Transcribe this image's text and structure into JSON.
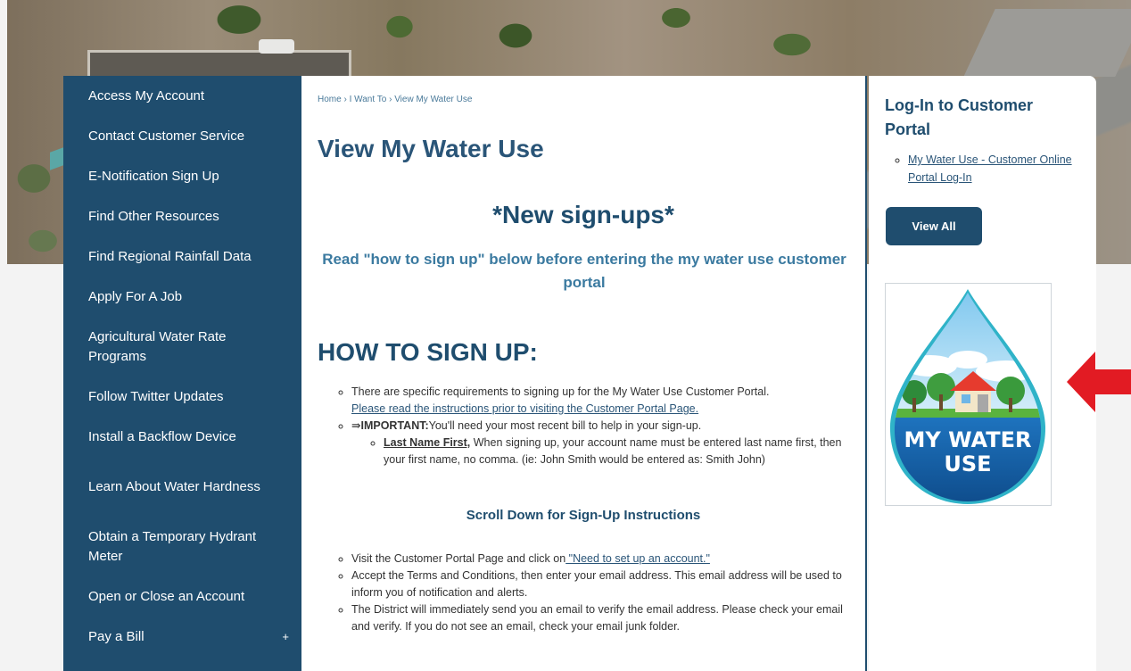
{
  "sidebar": {
    "items": [
      {
        "label": "Access My Account"
      },
      {
        "label": "Contact Customer Service"
      },
      {
        "label": "E-Notification Sign Up"
      },
      {
        "label": "Find Other Resources"
      },
      {
        "label": "Find Regional Rainfall Data"
      },
      {
        "label": "Apply For A Job"
      },
      {
        "label": "Agricultural Water Rate Programs"
      },
      {
        "label": "Follow Twitter Updates"
      },
      {
        "label": "Install a Backflow Device"
      },
      {
        "label": "Learn About Water Hardness"
      },
      {
        "label": "Obtain a Temporary Hydrant Meter"
      },
      {
        "label": "Open or Close an Account"
      },
      {
        "label": "Pay a Bill",
        "expand": "+"
      }
    ]
  },
  "breadcrumb": {
    "home": "Home",
    "sep": "›",
    "i_want_to": "I Want To",
    "current": "View My Water Use"
  },
  "main": {
    "title": "View My Water Use",
    "new_signups": "*New sign-ups*",
    "read_note": "Read \"how to sign up\" below before entering the my water use customer portal",
    "how_title": "HOW TO SIGN UP:",
    "req_text": "There are specific requirements to signing up for the My Water Use Customer Portal.",
    "req_link": "Please read the instructions prior to visiting the Customer Portal Page.",
    "important_arrow": "⇛",
    "important_label": "IMPORTANT:",
    "important_text": "You'll need your most recent bill to help in your sign-up.",
    "last_name_label": "Last Name First,",
    "last_name_text": " When signing up, your account name must be entered last name first, then your first name, no comma. (ie: John Smith would be entered as: Smith John)",
    "scroll_note": "Scroll Down for Sign-Up Instructions",
    "step1_text": "Visit the Customer Portal Page and click on",
    "step1_link": " \"Need to set up an account.\"",
    "step2_text": "Accept the Terms and Conditions, then enter your email address.  This email address will be used to inform you of notification and alerts.",
    "step3_text": "The District will immediately send you an email to verify the email address. Please check your email and verify. If you do not see an email, check your email junk folder."
  },
  "right": {
    "title": "Log-In to Customer Portal",
    "link": "My Water Use - Customer Online Portal Log-In",
    "view_all": "View All",
    "logo_line1": "MY WATER",
    "logo_line2": "USE"
  },
  "colors": {
    "navy": "#1f4d6e",
    "accent_blue": "#3b7aa0",
    "arrow_red": "#e21b23"
  }
}
